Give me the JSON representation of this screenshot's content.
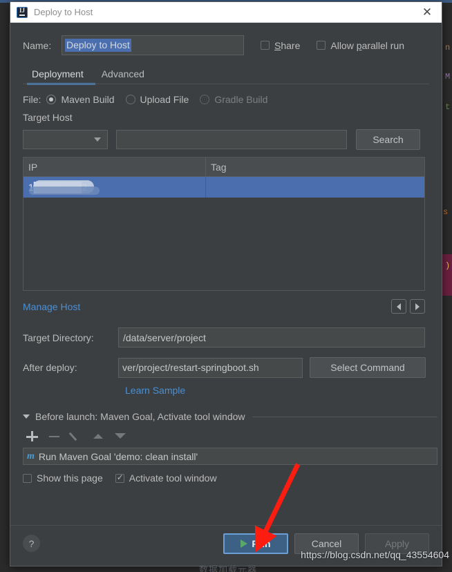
{
  "window": {
    "title": "Deploy to Host",
    "app_icon": "intellij-idea-icon",
    "close_icon": "close-icon"
  },
  "name_row": {
    "label": "Name:",
    "value": "Deploy to Host",
    "share": {
      "label": "Share",
      "checked": false
    },
    "allow_parallel": {
      "label": "Allow parallel run",
      "checked": false
    }
  },
  "tabs": [
    {
      "label": "Deployment",
      "active": true
    },
    {
      "label": "Advanced",
      "active": false
    }
  ],
  "file_row": {
    "label": "File:",
    "options": [
      {
        "label": "Maven Build",
        "selected": true,
        "disabled": false
      },
      {
        "label": "Upload File",
        "selected": false,
        "disabled": false
      },
      {
        "label": "Gradle Build",
        "selected": false,
        "disabled": true
      }
    ]
  },
  "target_host": {
    "section_label": "Target Host",
    "combo_value": "",
    "combo_icon": "chevron-down-icon",
    "search_value": "",
    "search_placeholder": "",
    "search_button": "Search",
    "table": {
      "columns": [
        "IP",
        "Tag"
      ],
      "rows": [
        {
          "ip": "1███████2",
          "tag": "",
          "selected": true,
          "redacted": true
        }
      ]
    },
    "manage_host_link": "Manage Host",
    "prev_icon": "arrow-left-icon",
    "next_icon": "arrow-right-icon"
  },
  "target_directory": {
    "label": "Target Directory:",
    "value": "/data/server/project"
  },
  "after_deploy": {
    "label": "After deploy:",
    "value": "ver/project/restart-springboot.sh",
    "select_command_button": "Select Command",
    "learn_sample_link": "Learn Sample"
  },
  "before_launch": {
    "title": "Before launch: Maven Goal, Activate tool window",
    "collapse_icon": "chevron-down-icon",
    "toolbar": [
      {
        "icon": "add-icon",
        "enabled": true
      },
      {
        "icon": "remove-icon",
        "enabled": false
      },
      {
        "icon": "edit-pencil-icon",
        "enabled": false
      },
      {
        "icon": "move-up-icon",
        "enabled": false
      },
      {
        "icon": "move-down-icon",
        "enabled": false
      }
    ],
    "items": [
      {
        "icon": "maven-icon",
        "icon_glyph": "m",
        "text": "Run Maven Goal 'demo: clean install'"
      }
    ],
    "show_this_page": {
      "label": "Show this page",
      "checked": false
    },
    "activate_tool_window": {
      "label": "Activate tool window",
      "checked": true
    }
  },
  "footer": {
    "help_icon": "help-icon",
    "help_glyph": "?",
    "run_button": {
      "label": "Run",
      "icon": "play-icon",
      "focused": true
    },
    "cancel_button": {
      "label": "Cancel"
    },
    "apply_button": {
      "label": "Apply",
      "disabled": true
    }
  },
  "annotations": {
    "arrow_color": "#fd1c10",
    "arrow_target": "run-button"
  },
  "watermarks": {
    "url": "https://blog.csdn.net/qq_43554604",
    "caption": "数据加载元器"
  },
  "background": {
    "code_fragments": [
      "n",
      "M",
      "t",
      "s",
      ")"
    ]
  },
  "colors": {
    "dialog_bg": "#3c3f41",
    "titlebar_bg": "#ffffff",
    "accent_blue": "#4b6eaf",
    "link_blue": "#4a8fd4",
    "tab_underline": "#4a88c7",
    "run_green": "#59a869"
  }
}
